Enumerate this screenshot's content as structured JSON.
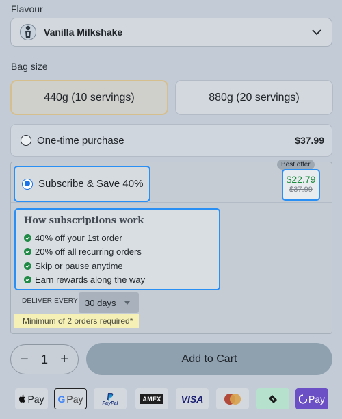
{
  "flavour": {
    "label": "Flavour",
    "selected": "Vanilla Milkshake"
  },
  "bag_size": {
    "label": "Bag size",
    "options": [
      {
        "label": "440g (10 servings)",
        "selected": true
      },
      {
        "label": "880g (20 servings)",
        "selected": false
      }
    ]
  },
  "purchase": {
    "one_time": {
      "label": "One-time purchase",
      "price": "$37.99",
      "selected": false
    },
    "subscribe": {
      "label": "Subscribe & Save 40%",
      "selected": true,
      "badge": "Best offer",
      "price": "$22.79",
      "original_price": "$37.99",
      "how_title": "How subscriptions work",
      "benefits": [
        "40% off your 1st order",
        "20% off all recurring orders",
        "Skip or pause anytime",
        "Earn rewards along the way"
      ],
      "deliver_label": "DELIVER EVERY",
      "deliver_value": "30 days",
      "minimum_note": "Minimum of 2 orders required*"
    }
  },
  "cart": {
    "quantity": "1",
    "minus": "−",
    "plus": "+",
    "add_label": "Add to Cart"
  },
  "payment_methods": [
    {
      "name": "apple-pay-icon",
      "label": "Pay"
    },
    {
      "name": "google-pay-icon",
      "label": "Pay"
    },
    {
      "name": "paypal-icon",
      "label": "PayPal"
    },
    {
      "name": "amex-icon",
      "label": "AMEX"
    },
    {
      "name": "visa-icon",
      "label": "VISA"
    },
    {
      "name": "mastercard-icon",
      "label": ""
    },
    {
      "name": "afterpay-icon",
      "label": ""
    },
    {
      "name": "opay-icon",
      "label": "Pay"
    }
  ],
  "colors": {
    "accent_blue": "#2a8ff5",
    "price_green": "#1a8a3b",
    "add_to_cart_bg": "#8fa0af"
  }
}
